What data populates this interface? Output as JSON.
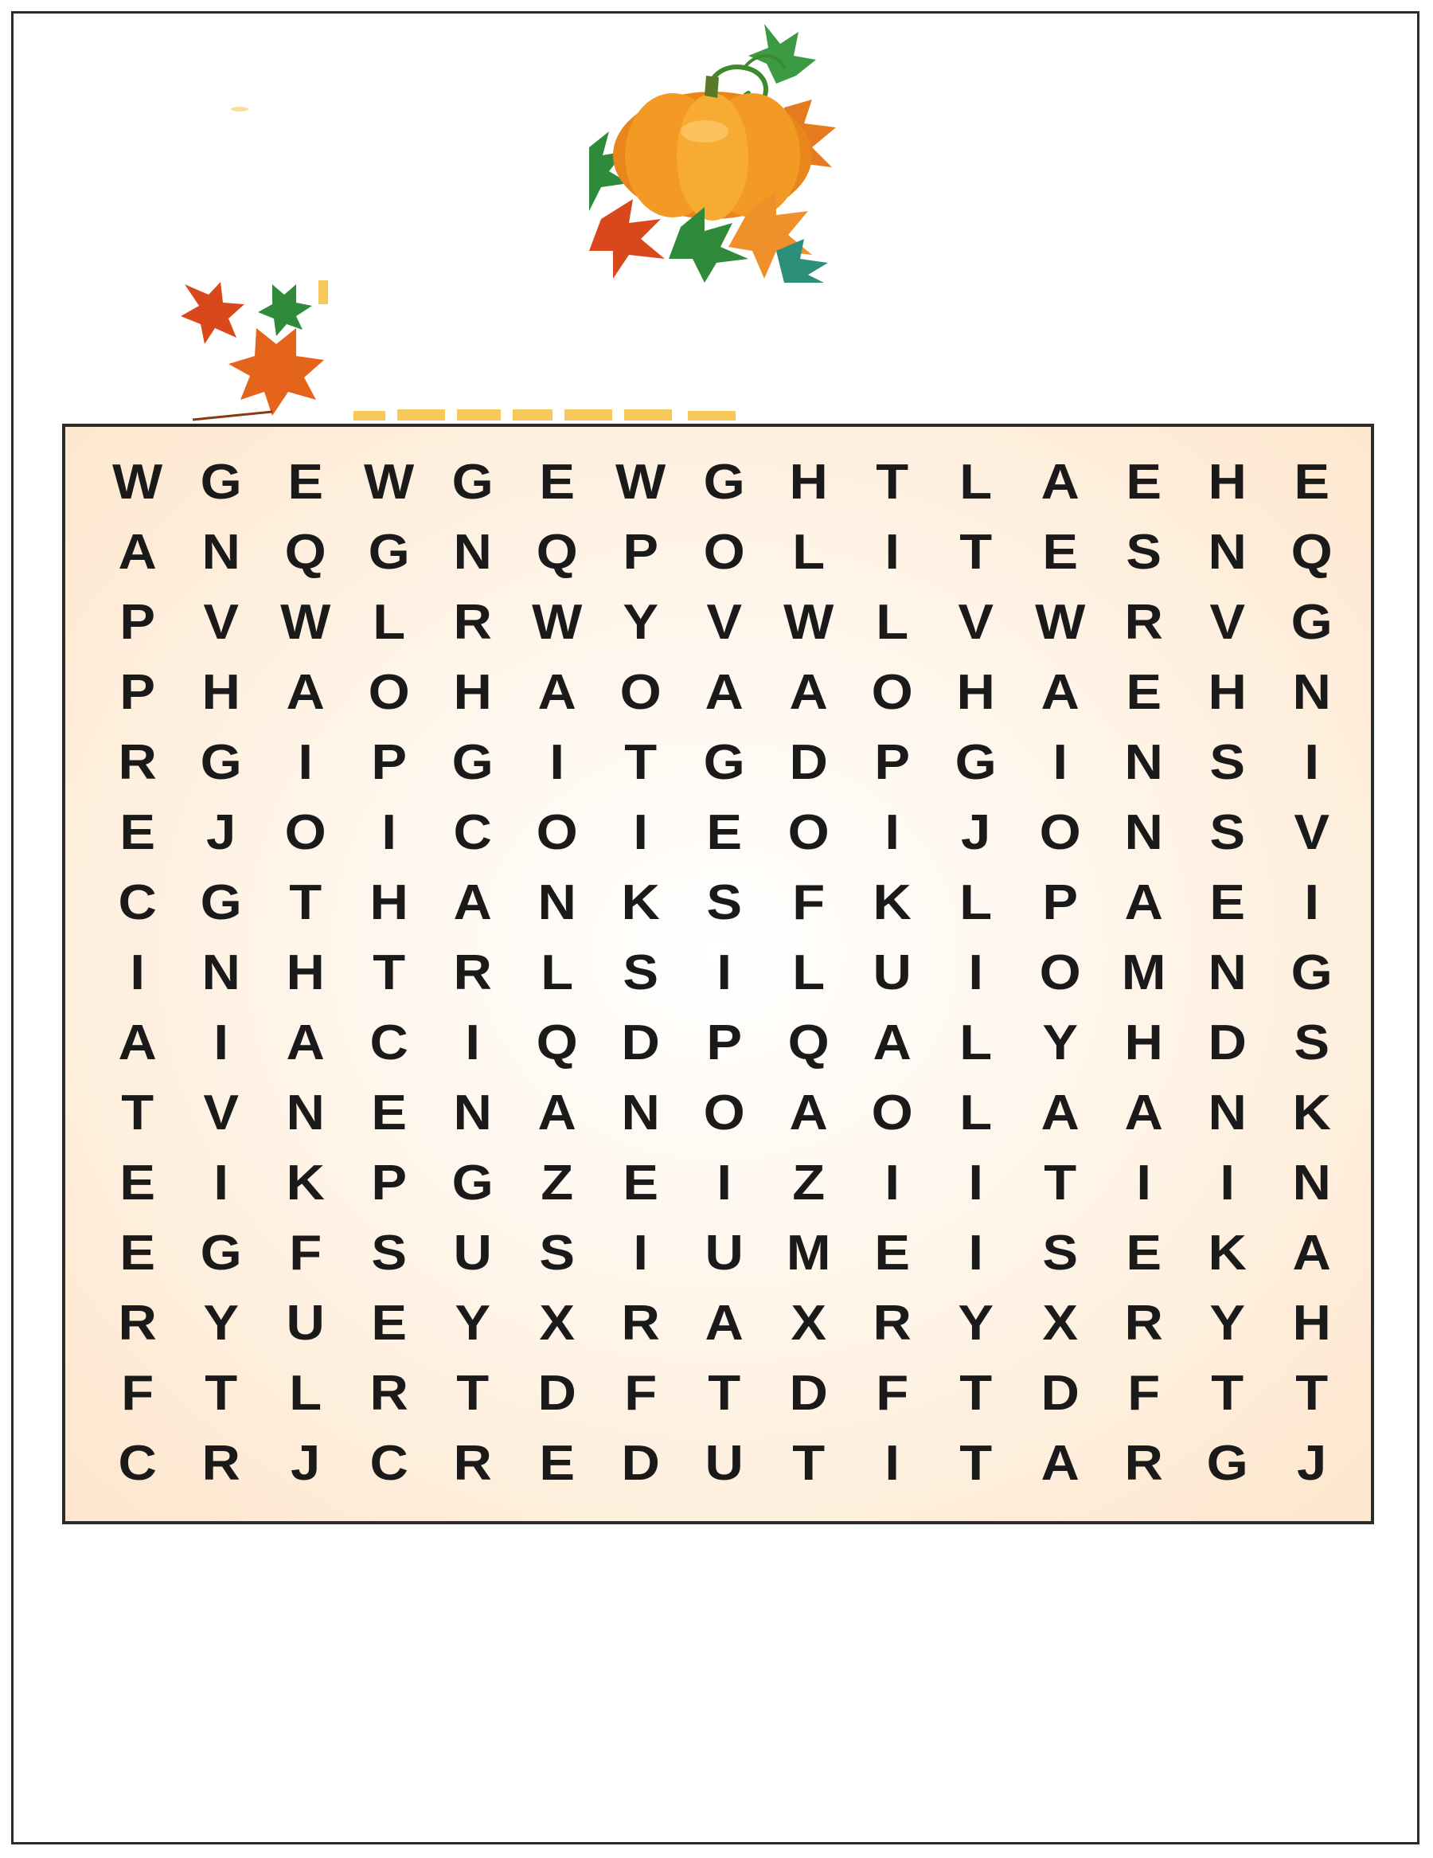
{
  "colors": {
    "grid_bg_center": "#ffffff",
    "grid_bg_edge": "#fde6cc",
    "pumpkin": "#f39a1e",
    "leaf_red": "#d9481b",
    "leaf_green": "#2f8a3c",
    "border": "#2b2b2b"
  },
  "decorations": [
    "pumpkin-illustration",
    "autumn-leaves-illustration"
  ],
  "grid": {
    "rows": [
      [
        "W",
        "G",
        "E",
        "W",
        "G",
        "E",
        "W",
        "G",
        "H",
        "T",
        "L",
        "A",
        "E",
        "H",
        "E"
      ],
      [
        "A",
        "N",
        "Q",
        "G",
        "N",
        "Q",
        "P",
        "O",
        "L",
        "I",
        "T",
        "E",
        "S",
        "N",
        "Q"
      ],
      [
        "P",
        "V",
        "W",
        "L",
        "R",
        "W",
        "Y",
        "V",
        "W",
        "L",
        "V",
        "W",
        "R",
        "V",
        "G"
      ],
      [
        "P",
        "H",
        "A",
        "O",
        "H",
        "A",
        "O",
        "A",
        "A",
        "O",
        "H",
        "A",
        "E",
        "H",
        "N"
      ],
      [
        "R",
        "G",
        "I",
        "P",
        "G",
        "I",
        "T",
        "G",
        "D",
        "P",
        "G",
        "I",
        "N",
        "S",
        "I"
      ],
      [
        "E",
        "J",
        "O",
        "I",
        "C",
        "O",
        "I",
        "E",
        "O",
        "I",
        "J",
        "O",
        "N",
        "S",
        "V"
      ],
      [
        "C",
        "G",
        "T",
        "H",
        "A",
        "N",
        "K",
        "S",
        "F",
        "K",
        "L",
        "P",
        "A",
        "E",
        "I"
      ],
      [
        "I",
        "N",
        "H",
        "T",
        "R",
        "L",
        "S",
        "I",
        "L",
        "U",
        "I",
        "O",
        "M",
        "N",
        "G"
      ],
      [
        "A",
        "I",
        "A",
        "C",
        "I",
        "Q",
        "D",
        "P",
        "Q",
        "A",
        "L",
        "Y",
        "H",
        "D",
        "S"
      ],
      [
        "T",
        "V",
        "N",
        "E",
        "N",
        "A",
        "N",
        "O",
        "A",
        "O",
        "L",
        "A",
        "A",
        "N",
        "K"
      ],
      [
        "E",
        "I",
        "K",
        "P",
        "G",
        "Z",
        "E",
        "I",
        "Z",
        "I",
        "I",
        "T",
        "I",
        "I",
        "N"
      ],
      [
        "E",
        "G",
        "F",
        "S",
        "U",
        "S",
        "I",
        "U",
        "M",
        "E",
        "I",
        "S",
        "E",
        "K",
        "A"
      ],
      [
        "R",
        "Y",
        "U",
        "E",
        "Y",
        "X",
        "R",
        "A",
        "X",
        "R",
        "Y",
        "X",
        "R",
        "Y",
        "H"
      ],
      [
        "F",
        "T",
        "L",
        "R",
        "T",
        "D",
        "F",
        "T",
        "D",
        "F",
        "T",
        "D",
        "F",
        "T",
        "T"
      ],
      [
        "C",
        "R",
        "J",
        "C",
        "R",
        "E",
        "D",
        "U",
        "T",
        "I",
        "T",
        "A",
        "R",
        "G",
        "J"
      ]
    ]
  }
}
